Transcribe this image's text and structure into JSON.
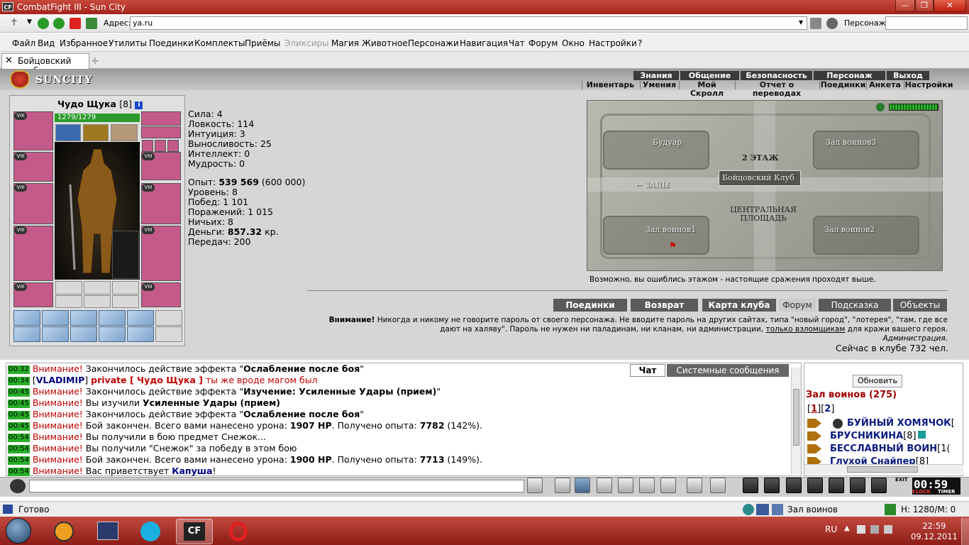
{
  "window": {
    "title": "CombatFight III - Sun City",
    "logo": "CF"
  },
  "address_bar": {
    "label": "Адрес:",
    "value": "ya.ru",
    "character_label": "Персонаж:"
  },
  "menu": [
    "Файл",
    "Вид",
    "Избранное",
    "Утилиты",
    "Поединки",
    "Комплекты",
    "Приёмы",
    "Эликсиры",
    "Магия",
    "Животное",
    "Персонажи",
    "Навигация",
    "Чат",
    "Форум",
    "Окно",
    "Настройки",
    "?"
  ],
  "tab": {
    "label": "Бойцовский клуб"
  },
  "game_nav": {
    "top": [
      "Знания",
      "Общение",
      "Безопасность",
      "Персонаж",
      "Выход"
    ],
    "bottom": [
      "Инвентарь",
      "Умения",
      "Мой Скролл",
      "Отчет о переводах",
      "Поединки",
      "Анкета",
      "Настройки"
    ]
  },
  "brand": "SUNCITY",
  "character": {
    "name": "Чудо Щука",
    "level": "[8]",
    "hp": "1279/1279",
    "slot_level_badge": "VIII",
    "stats": [
      {
        "label": "Сила:",
        "value": "4"
      },
      {
        "label": "Ловкость:",
        "value": "114"
      },
      {
        "label": "Интуиция:",
        "value": "3"
      },
      {
        "label": "Выносливость:",
        "value": "25"
      },
      {
        "label": "Интеллект:",
        "value": "0"
      },
      {
        "label": "Мудрость:",
        "value": "0"
      }
    ],
    "exp_label": "Опыт:",
    "exp": "539 569",
    "exp_next": "(600 000)",
    "level_label": "Уровень:",
    "level_value": "8",
    "wins_label": "Побед:",
    "wins": "1 101",
    "losses_label": "Поражений:",
    "losses": "1 015",
    "draws_label": "Ничьих:",
    "draws": "8",
    "money_label": "Деньги:",
    "money": "857.32",
    "money_unit": "кр.",
    "transfers_label": "Передач:",
    "transfers": "200"
  },
  "map": {
    "labels": {
      "boudoir": "Будуар",
      "hall3": "Зал воинов3",
      "floor": "2 ЭТАЖ",
      "club": "Бойцовский Клуб",
      "halls": "← ЗАЛЫ",
      "square": "ЦЕНТРАЛЬНАЯ ПЛОЩАДЬ",
      "hall1": "Зал воинов1",
      "hall2": "Зал воинов2"
    },
    "note": "Возможно, вы ошиблись этажом - настоящие сражения проходят выше."
  },
  "game_buttons": [
    "Поединки",
    "Возврат",
    "Карта клуба",
    "Форум",
    "Подсказка",
    "Объекты"
  ],
  "warning": {
    "bold": "Внимание!",
    "text1": " Никогда и никому не говорите пароль от своего персонажа. Не вводите пароль на других сайтах, типа \"новый город\", \"лотерея\", \"там, где все",
    "text2": "дают на халяву\". Пароль не нужен ни паладинам, ни кланам, ни администрации, ",
    "link": "только взломщикам",
    "text3": " для кражи вашего героя.",
    "sign": "Администрация."
  },
  "online": "Сейчас в клубе 732 чел.",
  "chat_tabs": {
    "chat": "Чат",
    "system": "Системные сообщения"
  },
  "chat": [
    {
      "time": "00:32",
      "parts": [
        [
          "red",
          "Внимание!"
        ],
        [
          "",
          " Закончилось действие эффекта \""
        ],
        [
          "b",
          "Ослабление после боя"
        ],
        [
          "",
          "\""
        ]
      ]
    },
    {
      "time": "00:34",
      "parts": [
        [
          "",
          "["
        ],
        [
          "bl",
          "VLADIMIP"
        ],
        [
          "",
          "] "
        ],
        [
          "redb",
          "private [ Чудо Щука ]"
        ],
        [
          "red",
          " ты же вроде магом был"
        ]
      ]
    },
    {
      "time": "00:45",
      "parts": [
        [
          "red",
          "Внимание!"
        ],
        [
          "",
          " Закончилось действие эффекта \""
        ],
        [
          "b",
          "Изучение: Усиленные Удары (прием)"
        ],
        [
          "",
          "\""
        ]
      ]
    },
    {
      "time": "00:45",
      "parts": [
        [
          "red",
          "Внимание!"
        ],
        [
          "",
          " Вы изучили "
        ],
        [
          "b",
          "Усиленные Удары (прием)"
        ]
      ]
    },
    {
      "time": "00:45",
      "parts": [
        [
          "red",
          "Внимание!"
        ],
        [
          "",
          " Закончилось действие эффекта \""
        ],
        [
          "b",
          "Ослабление после боя"
        ],
        [
          "",
          "\""
        ]
      ]
    },
    {
      "time": "00:45",
      "parts": [
        [
          "red",
          "Внимание!"
        ],
        [
          "",
          " Бой закончен. Всего вами нанесено урона: "
        ],
        [
          "b",
          "1907 HP"
        ],
        [
          "",
          ". Получено опыта: "
        ],
        [
          "b",
          "7782"
        ],
        [
          "",
          " (142%)."
        ]
      ]
    },
    {
      "time": "00:54",
      "parts": [
        [
          "red",
          "Внимание!"
        ],
        [
          "",
          " Вы получили в бою предмет Снежок..."
        ]
      ]
    },
    {
      "time": "00:54",
      "parts": [
        [
          "red",
          "Внимание!"
        ],
        [
          "",
          " Вы получили \"Снежок\" за победу в этом бою"
        ]
      ]
    },
    {
      "time": "00:54",
      "parts": [
        [
          "red",
          "Внимание!"
        ],
        [
          "",
          " Бой закончен. Всего вами нанесено урона: "
        ],
        [
          "b",
          "1900 HP"
        ],
        [
          "",
          ". Получено опыта: "
        ],
        [
          "b",
          "7713"
        ],
        [
          "",
          " (149%)."
        ]
      ]
    },
    {
      "time": "00:54",
      "parts": [
        [
          "red",
          "Внимание!"
        ],
        [
          "",
          " Вас приветствует "
        ],
        [
          "bl",
          "Капуша"
        ],
        [
          "",
          "!"
        ]
      ]
    }
  ],
  "side": {
    "refresh": "Обновить",
    "hall": "Зал воинов (275)",
    "page1": "1",
    "page2": "2",
    "players": [
      {
        "name": "БУЙНЫЙ ХОМЯЧОК",
        "extra": "["
      },
      {
        "name": "БРУСНИКИНА",
        "extra": "[8]"
      },
      {
        "name": "БЕССЛАВНЫЙ ВОИН",
        "extra": "[1("
      },
      {
        "name": "Глухой Снайпер",
        "extra": "[8]"
      }
    ]
  },
  "clock": "00:59",
  "clock_labels": {
    "exit": "EXIT",
    "clock": "CLOCK",
    "timer": "TIMER"
  },
  "status": {
    "left": "Готово",
    "room": "Зал воинов",
    "hp": "Н: 1280/М: 0"
  },
  "taskbar": {
    "lang": "RU",
    "time": "22:59",
    "date": "09.12.2011"
  }
}
